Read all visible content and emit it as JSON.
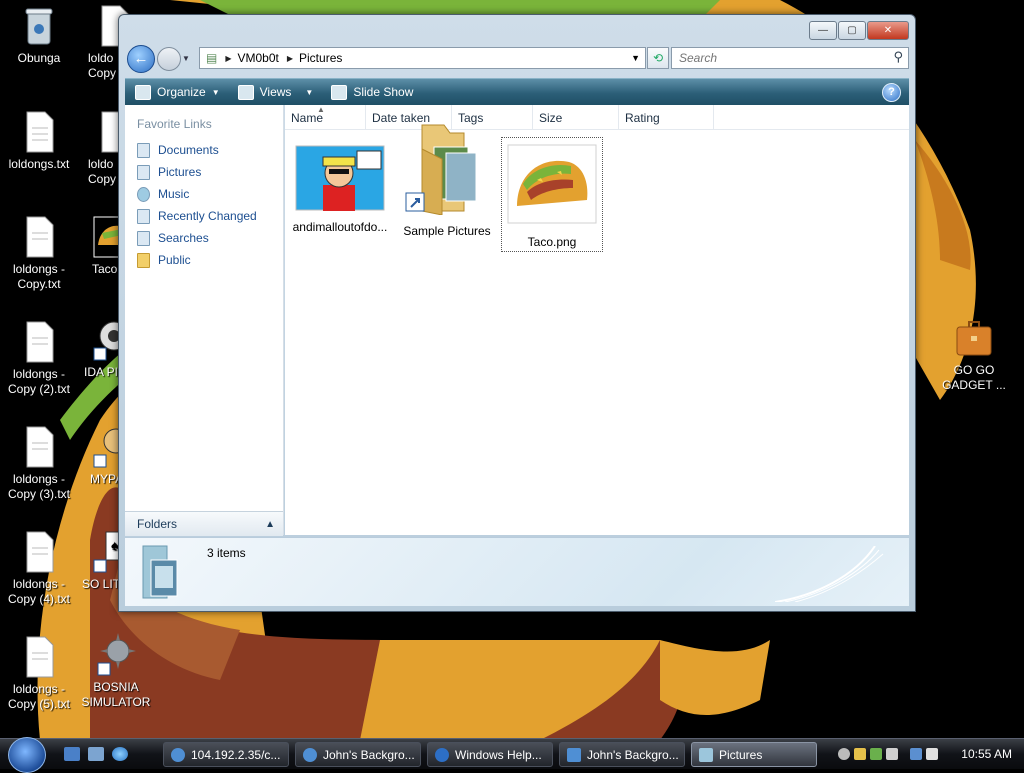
{
  "desktop": {
    "icons": [
      {
        "label": "Obunga"
      },
      {
        "label": "loldongs.txt"
      },
      {
        "label": "loldongs - Copy.txt"
      },
      {
        "label": "loldongs - Copy (2).txt"
      },
      {
        "label": "loldongs - Copy (3).txt"
      },
      {
        "label": "loldongs - Copy (4).txt"
      },
      {
        "label": "loldongs - Copy (5).txt"
      },
      {
        "label": "loldo Copy"
      },
      {
        "label": "loldo Copy"
      },
      {
        "label": "Taco"
      },
      {
        "label": "IDA PI"
      },
      {
        "label": "MYPA"
      },
      {
        "label": "SO LIT"
      },
      {
        "label": "BOSNIA SIMULATOR"
      },
      {
        "label": "GO GO GADGET ..."
      }
    ]
  },
  "window": {
    "address": {
      "root": "VM0b0t",
      "folder": "Pictures"
    },
    "search_placeholder": "Search",
    "toolbar": {
      "organize": "Organize",
      "views": "Views",
      "slideshow": "Slide Show",
      "help": "?"
    },
    "favorite_links_title": "Favorite Links",
    "links": [
      "Documents",
      "Pictures",
      "Music",
      "Recently Changed",
      "Searches",
      "Public"
    ],
    "folders_label": "Folders",
    "columns": [
      "Name",
      "Date taken",
      "Tags",
      "Size",
      "Rating"
    ],
    "items": [
      {
        "label": "andimalloutofdo..."
      },
      {
        "label": "Sample Pictures"
      },
      {
        "label": "Taco.png"
      }
    ],
    "status": "3 items"
  },
  "taskbar": {
    "tasks": [
      {
        "label": "104.192.2.35/c..."
      },
      {
        "label": "John's Backgro..."
      },
      {
        "label": "Windows Help..."
      },
      {
        "label": "John's Backgro..."
      },
      {
        "label": "Pictures"
      }
    ],
    "clock": "10:55 AM"
  },
  "colors": {
    "accent": "#1d4f91",
    "toolbar": "#2c5f78",
    "taco_shell": "#e3a12f",
    "lettuce": "#7ab43a"
  }
}
